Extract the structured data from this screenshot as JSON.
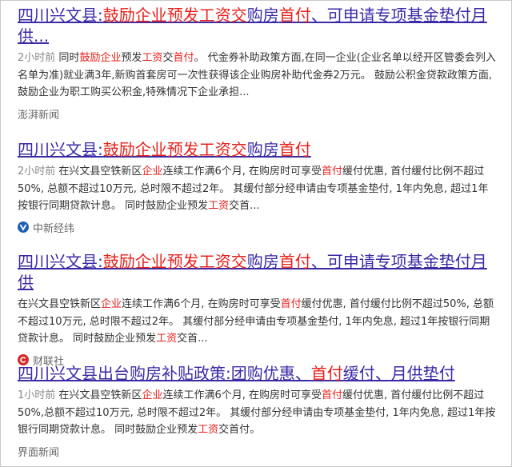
{
  "results": [
    {
      "title_parts": [
        {
          "t": "四川兴文县:",
          "h": false
        },
        {
          "t": "鼓励企业预发工资交",
          "h": true
        },
        {
          "t": "购房",
          "h": false
        },
        {
          "t": "首付",
          "h": true
        },
        {
          "t": "、可申请专项基金垫付月供...",
          "h": false
        }
      ],
      "time": "2小时前",
      "snippet_parts": [
        {
          "t": "同时",
          "h": false
        },
        {
          "t": "鼓励企业",
          "h": true
        },
        {
          "t": "预发",
          "h": false
        },
        {
          "t": "工资",
          "h": true
        },
        {
          "t": "交",
          "h": false
        },
        {
          "t": "首付",
          "h": true
        },
        {
          "t": "。 代金券补助政策方面,在同一企业(企业名单以经开区管委会列入名单为准)就业满3年,新购首套房可一次性获得该企业购房补助代金券2万元。 鼓励公积金贷款政策方面,鼓励企业为职工购买公积金,特殊情况下企业承担...",
          "h": false
        }
      ],
      "source": "澎湃新闻",
      "icon": ""
    },
    {
      "title_parts": [
        {
          "t": "四川兴文县:",
          "h": false
        },
        {
          "t": "鼓励企业预发工资交",
          "h": true
        },
        {
          "t": "购房",
          "h": false
        },
        {
          "t": "首付",
          "h": true
        }
      ],
      "time": "2小时前",
      "snippet_parts": [
        {
          "t": "在兴文县空铁新区",
          "h": false
        },
        {
          "t": "企业",
          "h": true
        },
        {
          "t": "连续工作满6个月, 在购房时可享受",
          "h": false
        },
        {
          "t": "首付",
          "h": true
        },
        {
          "t": "缓付优惠, 首付缓付比例不超过50%, 总额不超过10万元, 总时限不超过2年。 其缓付部分经申请由专项基金垫付, 1年内免息, 超过1年按银行同期贷款计息。 同时鼓励企业预发",
          "h": false
        },
        {
          "t": "工资",
          "h": true
        },
        {
          "t": "交首...",
          "h": false
        }
      ],
      "source": "中新经纬",
      "icon": "blue-v"
    },
    {
      "title_parts": [
        {
          "t": "四川兴文县:",
          "h": false
        },
        {
          "t": "鼓励企业预发工资交",
          "h": true
        },
        {
          "t": "购房",
          "h": false
        },
        {
          "t": "首付",
          "h": true
        },
        {
          "t": "、可申请专项基金垫付月供",
          "h": false
        }
      ],
      "time": "",
      "snippet_parts": [
        {
          "t": "在兴文县空铁新区",
          "h": false
        },
        {
          "t": "企业",
          "h": true
        },
        {
          "t": "连续工作满6个月, 在购房时可享受",
          "h": false
        },
        {
          "t": "首付",
          "h": true
        },
        {
          "t": "缓付优惠, 首付缓付比例不超过50%, 总额不超过10万元, 总时限不超过2年。 其缓付部分经申请由专项基金垫付, 1年内免息, 超过1年按银行同期贷款计息。 同时鼓励企业预发",
          "h": false
        },
        {
          "t": "工资",
          "h": true
        },
        {
          "t": "交首...",
          "h": false
        }
      ],
      "source": "财联社",
      "icon": "red-c"
    },
    {
      "title_parts": [
        {
          "t": "四川兴文县出台购房补贴政策:团购优惠、",
          "h": false
        },
        {
          "t": "首付",
          "h": true
        },
        {
          "t": "缓付、月供垫付",
          "h": false
        }
      ],
      "time": "1小时前",
      "snippet_parts": [
        {
          "t": "在兴文县空铁新区",
          "h": false
        },
        {
          "t": "企业",
          "h": true
        },
        {
          "t": "连续工作满6个月, 在购房时可享受",
          "h": false
        },
        {
          "t": "首付",
          "h": true
        },
        {
          "t": "缓付优惠, 首付缓付比例不超过50%,总额不超过10万元, 总时限不超过2年。 其缓付部分经申请由专项基金垫付, 1年内免息, 超过1年按银行同期贷款计息。 同时鼓励企业预发",
          "h": false
        },
        {
          "t": "工资",
          "h": true
        },
        {
          "t": "交首付。",
          "h": false
        }
      ],
      "source": "界面新闻",
      "icon": ""
    }
  ],
  "colors": {
    "title": "#3a2aa6",
    "highlight": "#e8201a",
    "text": "#333333",
    "time": "#8a8a8a",
    "source": "#666666"
  }
}
